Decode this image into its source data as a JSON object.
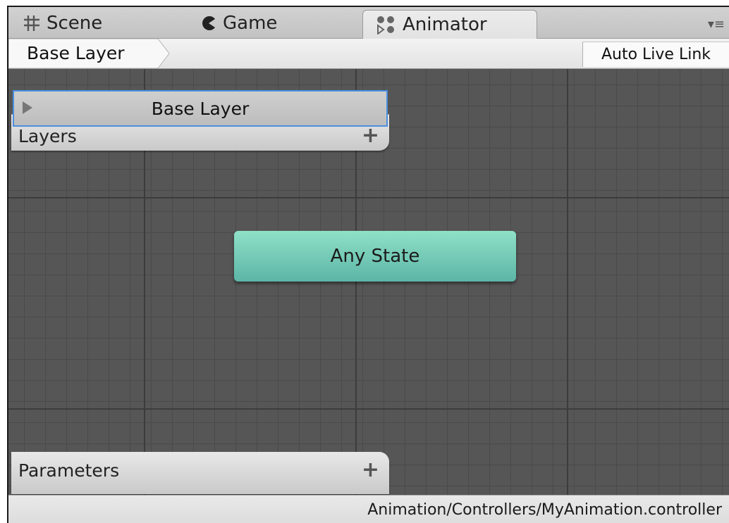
{
  "tabs": [
    {
      "label": "Scene",
      "icon": "grid-hash-icon"
    },
    {
      "label": "Game",
      "icon": "game-pacman-icon"
    },
    {
      "label": "Animator",
      "icon": "animator-icon",
      "active": true
    }
  ],
  "breadcrumb": {
    "label": "Base Layer"
  },
  "toolbar": {
    "auto_live_link_label": "Auto Live Link"
  },
  "layers_panel": {
    "title": "Layers",
    "add_label": "+",
    "items": [
      {
        "name": "Base Layer",
        "selected": true
      }
    ]
  },
  "parameters_panel": {
    "title": "Parameters",
    "add_label": "+"
  },
  "graph": {
    "nodes": [
      {
        "label": "Any State",
        "color": "#6fc9b5"
      }
    ]
  },
  "status": {
    "path": "Animation/Controllers/MyAnimation.controller"
  },
  "colors": {
    "selection_outline": "#4a8fe0",
    "any_state": "#6fc9b5",
    "grid_bg": "#565656"
  }
}
